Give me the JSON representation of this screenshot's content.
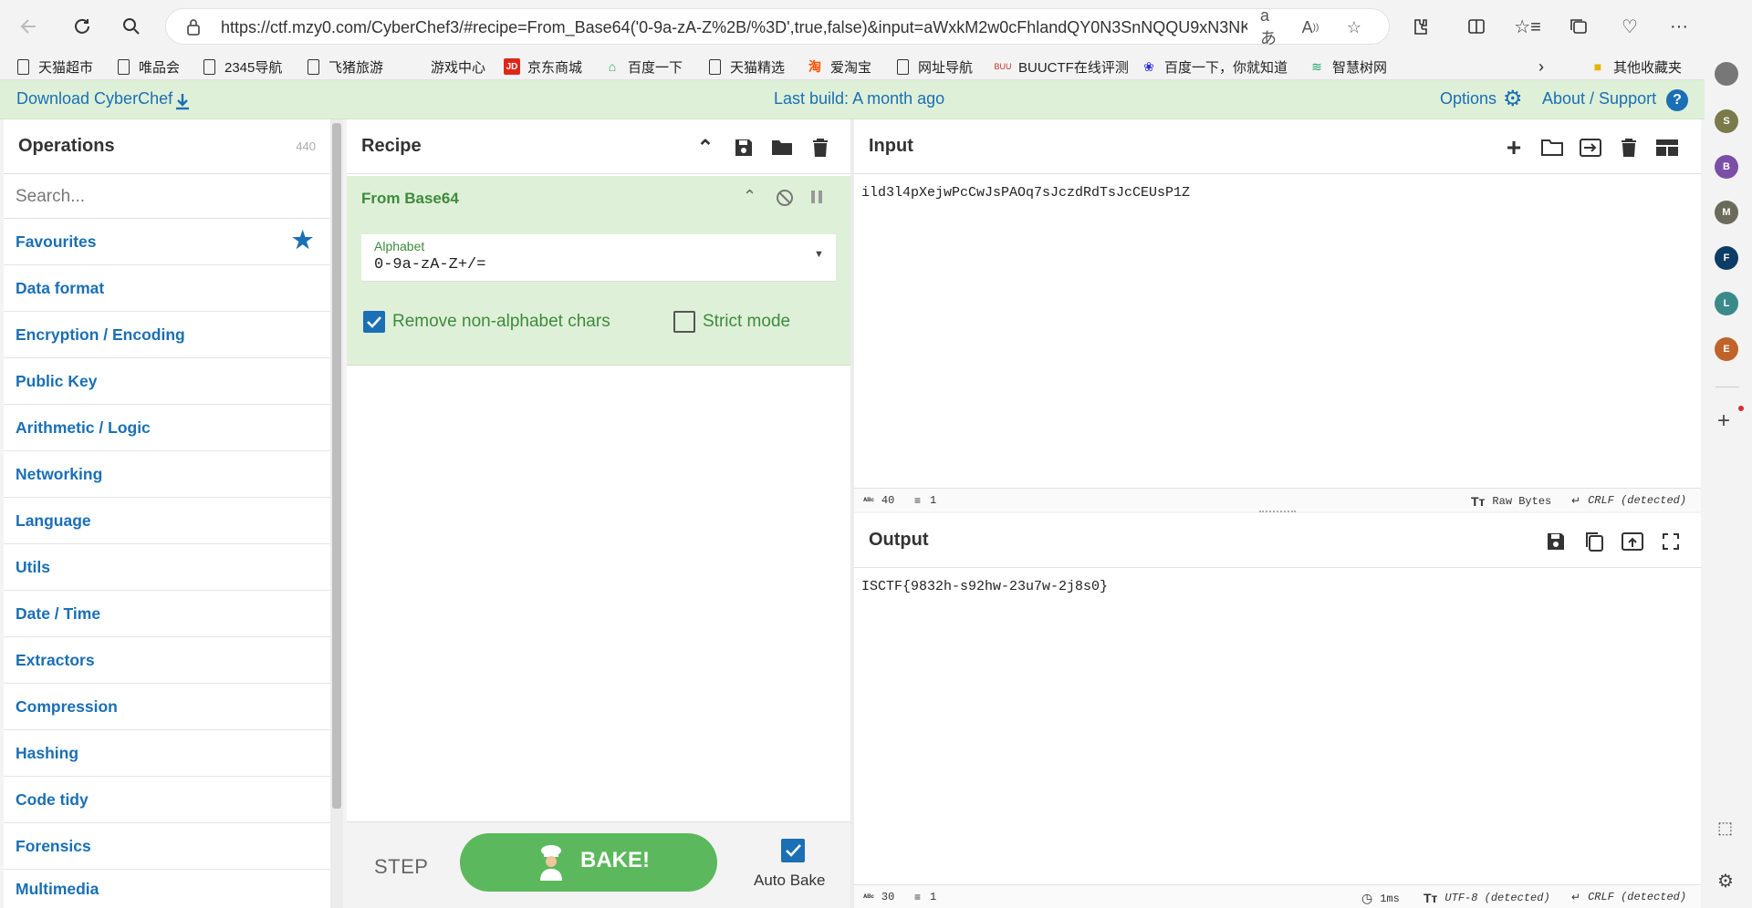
{
  "browser": {
    "url": "https://ctf.mzy0.com/CyberChef3/#recipe=From_Base64('0-9a-zA-Z%2B/%3D',true,false)&input=aWxkM2w0cFhlandQY0N3SnNQQU9xN3NKY3p..."
  },
  "bookmarks": [
    {
      "label": "天猫超市",
      "icon": "doc-icon"
    },
    {
      "label": "唯品会",
      "icon": "doc-icon"
    },
    {
      "label": "2345导航",
      "icon": "doc-icon"
    },
    {
      "label": "飞猪旅游",
      "icon": "doc-icon"
    },
    {
      "label": "游戏中心",
      "icon": "none"
    },
    {
      "label": "京东商城",
      "icon": "jd-icon",
      "color": "#e1251b"
    },
    {
      "label": "百度一下",
      "icon": "house-icon",
      "color": "#2bab4a"
    },
    {
      "label": "天猫精选",
      "icon": "doc-icon"
    },
    {
      "label": "爱淘宝",
      "icon": "taobao-icon",
      "color": "#ff5000"
    },
    {
      "label": "网址导航",
      "icon": "doc-icon"
    },
    {
      "label": "BUUCTF在线评测",
      "icon": "buu-icon",
      "color": "#c9302c"
    },
    {
      "label": "百度一下，你就知道",
      "icon": "paw-icon",
      "color": "#2932e1"
    },
    {
      "label": "智慧树网",
      "icon": "zhs-icon",
      "color": "#1aa260"
    }
  ],
  "bookmarks_other": "其他收藏夹",
  "side_avatars": [
    {
      "letter": "",
      "color": "#777777"
    },
    {
      "letter": "S",
      "color": "#7a7a4a"
    },
    {
      "letter": "B",
      "color": "#7b4ea8"
    },
    {
      "letter": "M",
      "color": "#6b6b5b"
    },
    {
      "letter": "F",
      "color": "#0d3d66"
    },
    {
      "letter": "L",
      "color": "#3a8a8a"
    },
    {
      "letter": "E",
      "color": "#c0632a"
    }
  ],
  "banner": {
    "download": "Download CyberChef",
    "last_build": "Last build: A month ago",
    "options": "Options",
    "about": "About / Support"
  },
  "operations": {
    "title": "Operations",
    "count": "440",
    "search_placeholder": "Search...",
    "categories": [
      "Favourites",
      "Data format",
      "Encryption / Encoding",
      "Public Key",
      "Arithmetic / Logic",
      "Networking",
      "Language",
      "Utils",
      "Date / Time",
      "Extractors",
      "Compression",
      "Hashing",
      "Code tidy",
      "Forensics",
      "Multimedia"
    ]
  },
  "recipe": {
    "title": "Recipe",
    "op_name": "From Base64",
    "alphabet_label": "Alphabet",
    "alphabet_value": "0-9a-zA-Z+/=",
    "remove_nonalpha": "Remove non-alphabet chars",
    "remove_nonalpha_checked": true,
    "strict_mode": "Strict mode",
    "strict_mode_checked": false,
    "step": "STEP",
    "bake": "BAKE!",
    "auto_bake": "Auto Bake",
    "auto_bake_checked": true
  },
  "input": {
    "title": "Input",
    "text": "ild3l4pXejwPcCwJsPAOq7sJczdRdTsJcCEUsP1Z",
    "length": "40",
    "lines": "1",
    "encoding": "Raw Bytes",
    "eol": "CRLF (detected)"
  },
  "output": {
    "title": "Output",
    "text": "ISCTF{9832h-s92hw-23u7w-2j8s0}",
    "length": "30",
    "lines": "1",
    "time": "1ms",
    "encoding": "UTF-8 (detected)",
    "eol": "CRLF (detected)"
  },
  "colors": {
    "accent_blue": "#1a6fb5",
    "banner_green": "#dff0d8",
    "op_green": "#dff0d8",
    "bake_green": "#5cb85c"
  }
}
